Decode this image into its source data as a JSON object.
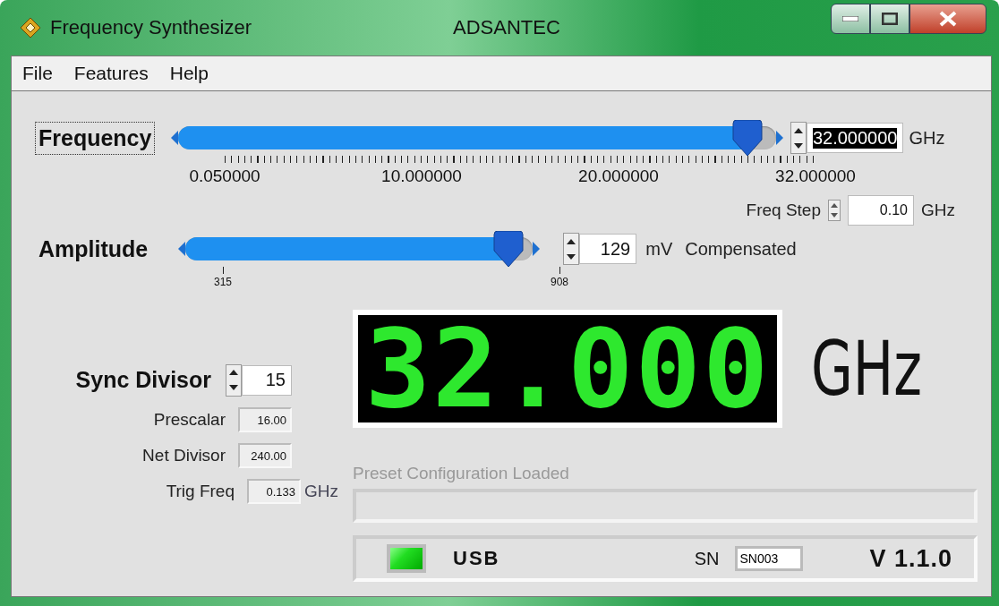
{
  "window": {
    "title": "Frequency Synthesizer",
    "vendor": "ADSANTEC"
  },
  "menu": [
    "File",
    "Features",
    "Help"
  ],
  "frequency": {
    "label": "Frequency",
    "focused": true,
    "level": 1,
    "value": "32.000000",
    "value_selected": true,
    "unit": "GHz",
    "scale": [
      "0.050000",
      "10.000000",
      "20.000000",
      "32.000000"
    ]
  },
  "freq_step": {
    "label": "Freq Step",
    "value": "0.10",
    "unit": "GHz"
  },
  "amplitude": {
    "label": "Amplitude",
    "level": 1,
    "scale": [
      "315",
      "908"
    ],
    "value": "129",
    "unit": "mV",
    "mode": "Compensated"
  },
  "sync_divisor": {
    "label": "Sync Divisor",
    "value": "15"
  },
  "readouts": [
    {
      "label": "Prescalar",
      "value": "16.00"
    },
    {
      "label": "Net Divisor",
      "value": "240.00"
    },
    {
      "label": "Trig Freq",
      "value": "0.133",
      "unit": "GHz"
    }
  ],
  "display": {
    "value": "32.000",
    "unit": "GHz"
  },
  "preset": {
    "label": "Preset Configuration Loaded",
    "level": 0
  },
  "status": {
    "usb_on": true,
    "usb_label": "USB",
    "sn_label": "SN",
    "sn": "SN003",
    "version": "V 1.1.0"
  }
}
